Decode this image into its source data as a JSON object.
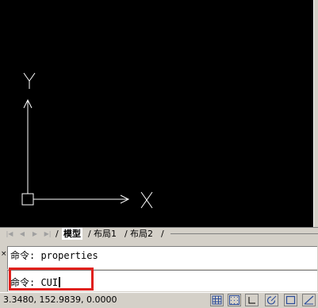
{
  "ucs": {
    "x_label": "X",
    "y_label": "Y"
  },
  "tabs": {
    "model": "模型",
    "layout1": "布局1",
    "layout2": "布局2",
    "separator": "/"
  },
  "command": {
    "close_glyph": "×",
    "history_line": "命令: properties",
    "input_prefix": "命令: CUI"
  },
  "status": {
    "coordinates": "3.3480, 152.9839, 0.0000",
    "buttons": [
      "snap-icon",
      "grid-icon",
      "ortho-icon",
      "polar-icon",
      "osnap-icon",
      "otrack-icon"
    ]
  },
  "colors": {
    "canvas": "#000000",
    "highlight": "#e0201c"
  }
}
